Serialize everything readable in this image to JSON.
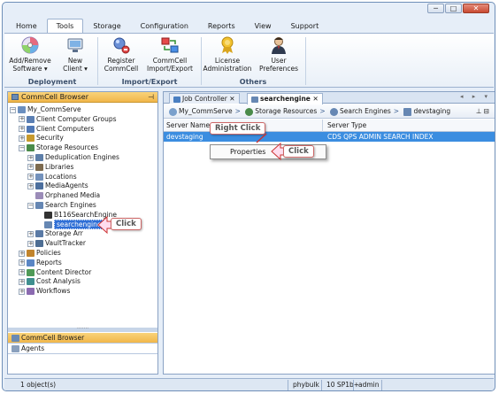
{
  "window": {
    "controls": [
      "─",
      "□",
      "✕"
    ]
  },
  "menubar": {
    "items": [
      "Home",
      "Tools",
      "Storage",
      "Configuration",
      "Reports",
      "View",
      "Support"
    ],
    "active": "Tools"
  },
  "ribbon": {
    "groups": [
      {
        "label": "Deployment",
        "buttons": [
          {
            "line1": "Add/Remove",
            "line2": "Software ▾",
            "icon": "add-remove-software-icon"
          },
          {
            "line1": "New",
            "line2": "Client ▾",
            "icon": "new-client-icon"
          }
        ]
      },
      {
        "label": "Import/Export",
        "buttons": [
          {
            "line1": "Register",
            "line2": "CommCell",
            "icon": "register-commcell-icon"
          },
          {
            "line1": "CommCell",
            "line2": "Import/Export",
            "icon": "commcell-import-export-icon"
          }
        ]
      },
      {
        "label": "Others",
        "buttons": [
          {
            "line1": "License",
            "line2": "Administration",
            "icon": "license-icon"
          },
          {
            "line1": "User",
            "line2": "Preferences",
            "icon": "user-preferences-icon"
          }
        ]
      }
    ]
  },
  "left_panel": {
    "title": "CommCell Browser",
    "pin": "⊣",
    "tree": [
      {
        "label": "My_CommServe",
        "level": 0,
        "expander": "−",
        "icon": "commserve-icon",
        "color": "#6b8fbf"
      },
      {
        "label": "Client Computer Groups",
        "level": 1,
        "expander": "+",
        "icon": "client-groups-icon",
        "color": "#5b7fb3"
      },
      {
        "label": "Client Computers",
        "level": 1,
        "expander": "+",
        "icon": "client-computers-icon",
        "color": "#4f78b6"
      },
      {
        "label": "Security",
        "level": 1,
        "expander": "+",
        "icon": "security-icon",
        "color": "#c79a2e"
      },
      {
        "label": "Storage Resources",
        "level": 1,
        "expander": "−",
        "icon": "storage-resources-icon",
        "color": "#4a8b4a"
      },
      {
        "label": "Deduplication Engines",
        "level": 2,
        "expander": "+",
        "icon": "dedup-icon",
        "color": "#5d7ea8"
      },
      {
        "label": "Libraries",
        "level": 2,
        "expander": "+",
        "icon": "libraries-icon",
        "color": "#7c6a4e"
      },
      {
        "label": "Locations",
        "level": 2,
        "expander": "+",
        "icon": "locations-icon",
        "color": "#7391bb"
      },
      {
        "label": "MediaAgents",
        "level": 2,
        "expander": "+",
        "icon": "media-agents-icon",
        "color": "#4c6f9e"
      },
      {
        "label": "Orphaned Media",
        "level": 2,
        "expander": "",
        "icon": "orphaned-media-icon",
        "color": "#9b8cb8"
      },
      {
        "label": "Search Engines",
        "level": 2,
        "expander": "−",
        "icon": "search-engines-icon",
        "color": "#6687b3"
      },
      {
        "label": "B116SearchEngine",
        "level": 3,
        "expander": "",
        "icon": "search-engine-node-icon",
        "color": "#333333"
      },
      {
        "label": "searchengine",
        "level": 3,
        "expander": "",
        "icon": "search-engine-node-icon",
        "color": "#6687b3",
        "selected": true
      },
      {
        "label": "Storage Arr",
        "level": 2,
        "expander": "+",
        "icon": "storage-arrays-icon",
        "color": "#5a7aa5"
      },
      {
        "label": "VaultTracker",
        "level": 2,
        "expander": "+",
        "icon": "vault-tracker-icon",
        "color": "#4d6d93"
      },
      {
        "label": "Policies",
        "level": 1,
        "expander": "+",
        "icon": "policies-icon",
        "color": "#c2842c"
      },
      {
        "label": "Reports",
        "level": 1,
        "expander": "+",
        "icon": "reports-icon",
        "color": "#5a86c5"
      },
      {
        "label": "Content Director",
        "level": 1,
        "expander": "+",
        "icon": "content-director-icon",
        "color": "#4f9a57"
      },
      {
        "label": "Cost Analysis",
        "level": 1,
        "expander": "+",
        "icon": "cost-analysis-icon",
        "color": "#3f8f8f"
      },
      {
        "label": "Workflows",
        "level": 1,
        "expander": "+",
        "icon": "workflows-icon",
        "color": "#8b6ab0"
      }
    ],
    "bottom_tabs": [
      "CommCell Browser",
      "Agents"
    ],
    "splitter": "·······"
  },
  "right_panel": {
    "tabs": [
      {
        "label": "Job Controller",
        "close": "✕",
        "active": false
      },
      {
        "label": "searchengine",
        "close": "✕",
        "active": true
      }
    ],
    "tab_nav": "◂ ▸ ▾",
    "breadcrumb": [
      "My_CommServe",
      "Storage Resources",
      "Search Engines",
      "devstaging"
    ],
    "breadcrumb_sep": ">",
    "breadcrumb_tools": "⊥ ⊟",
    "grid": {
      "columns": [
        "Server Name",
        "Server Type"
      ],
      "rows": [
        [
          "devstaging",
          "CDS QPS ADMIN SEARCH INDEX"
        ]
      ]
    },
    "context_menu": {
      "items": [
        "Properties"
      ]
    }
  },
  "annotations": {
    "right_click": "Right Click",
    "click_menu": "Click",
    "click_tree": "Click"
  },
  "status_bar": {
    "objects": "1 object(s)",
    "user": "phybulk",
    "version": "10 SP1b+",
    "role": "admin"
  }
}
